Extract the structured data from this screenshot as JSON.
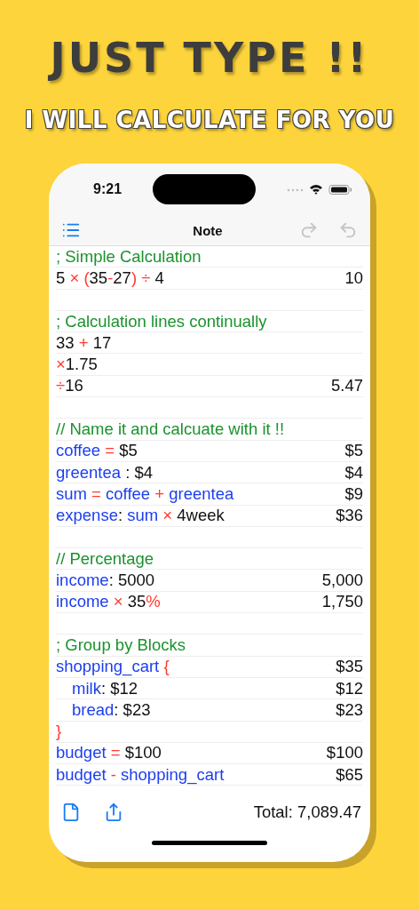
{
  "headline": "JUST TYPE !!",
  "subheadline": "I WILL CALCULATE FOR YOU",
  "status_bar": {
    "time": "9:21"
  },
  "nav_bar": {
    "title": "Note",
    "redo": {
      "disabled": true
    },
    "undo": {
      "disabled": true
    }
  },
  "blocks": [
    {
      "lines": [
        {
          "segments": [
            {
              "kind": "comment",
              "text": "; Simple Calculation"
            }
          ]
        },
        {
          "segments": [
            {
              "kind": "num",
              "text": "5 "
            },
            {
              "kind": "op",
              "text": "× ("
            },
            {
              "kind": "num",
              "text": "35"
            },
            {
              "kind": "op",
              "text": "-"
            },
            {
              "kind": "num",
              "text": "27"
            },
            {
              "kind": "op",
              "text": ") ÷ "
            },
            {
              "kind": "num",
              "text": "4"
            }
          ],
          "result": "10"
        }
      ]
    },
    {
      "lines": [
        {
          "segments": [
            {
              "kind": "comment",
              "text": "; Calculation lines continually"
            }
          ]
        },
        {
          "segments": [
            {
              "kind": "num",
              "text": "33 "
            },
            {
              "kind": "op",
              "text": "+ "
            },
            {
              "kind": "num",
              "text": "17"
            }
          ]
        },
        {
          "segments": [
            {
              "kind": "op",
              "text": "×"
            },
            {
              "kind": "num",
              "text": "1.75"
            }
          ]
        },
        {
          "segments": [
            {
              "kind": "op",
              "text": "÷"
            },
            {
              "kind": "num",
              "text": "16"
            }
          ],
          "result": "5.47"
        }
      ]
    },
    {
      "lines": [
        {
          "segments": [
            {
              "kind": "comment",
              "text": "// Name it and calcuate with it !!"
            }
          ]
        },
        {
          "segments": [
            {
              "kind": "name",
              "text": "coffee "
            },
            {
              "kind": "op",
              "text": "= "
            },
            {
              "kind": "num",
              "text": "$5"
            }
          ],
          "result": "$5"
        },
        {
          "segments": [
            {
              "kind": "name",
              "text": "greentea "
            },
            {
              "kind": "num",
              "text": ": $4"
            }
          ],
          "result": "$4"
        },
        {
          "segments": [
            {
              "kind": "name",
              "text": "sum "
            },
            {
              "kind": "op",
              "text": "= "
            },
            {
              "kind": "name",
              "text": "coffee "
            },
            {
              "kind": "op",
              "text": "+ "
            },
            {
              "kind": "name",
              "text": "greentea"
            }
          ],
          "result": "$9"
        },
        {
          "segments": [
            {
              "kind": "name",
              "text": "expense"
            },
            {
              "kind": "num",
              "text": ": "
            },
            {
              "kind": "name",
              "text": "sum "
            },
            {
              "kind": "op",
              "text": "× "
            },
            {
              "kind": "num",
              "text": "4week"
            }
          ],
          "result": "$36"
        }
      ]
    },
    {
      "lines": [
        {
          "segments": [
            {
              "kind": "comment",
              "text": "// Percentage"
            }
          ]
        },
        {
          "segments": [
            {
              "kind": "name",
              "text": "income"
            },
            {
              "kind": "num",
              "text": ": 5000"
            }
          ],
          "result": "5,000"
        },
        {
          "segments": [
            {
              "kind": "name",
              "text": "income "
            },
            {
              "kind": "op",
              "text": "× "
            },
            {
              "kind": "num",
              "text": "35"
            },
            {
              "kind": "op",
              "text": "%"
            }
          ],
          "result": "1,750"
        }
      ]
    },
    {
      "lines": [
        {
          "segments": [
            {
              "kind": "comment",
              "text": "; Group by Blocks"
            }
          ]
        },
        {
          "segments": [
            {
              "kind": "name",
              "text": "shopping_cart "
            },
            {
              "kind": "op",
              "text": "{"
            }
          ],
          "result": "$35",
          "children": [
            {
              "segments": [
                {
                  "kind": "name",
                  "text": "milk"
                },
                {
                  "kind": "num",
                  "text": ": $12"
                }
              ],
              "result": "$12"
            },
            {
              "segments": [
                {
                  "kind": "name",
                  "text": "bread"
                },
                {
                  "kind": "num",
                  "text": ": $23"
                }
              ],
              "result": "$23"
            }
          ]
        },
        {
          "segments": [
            {
              "kind": "op",
              "text": "}"
            }
          ]
        },
        {
          "segments": [
            {
              "kind": "name",
              "text": "budget "
            },
            {
              "kind": "op",
              "text": "= "
            },
            {
              "kind": "num",
              "text": "$100"
            }
          ],
          "result": "$100"
        },
        {
          "segments": [
            {
              "kind": "name",
              "text": "budget "
            },
            {
              "kind": "op",
              "text": "- "
            },
            {
              "kind": "name",
              "text": "shopping_cart"
            }
          ],
          "result": "$65"
        }
      ]
    }
  ],
  "footer": {
    "total": "Total: 7,089.47"
  }
}
